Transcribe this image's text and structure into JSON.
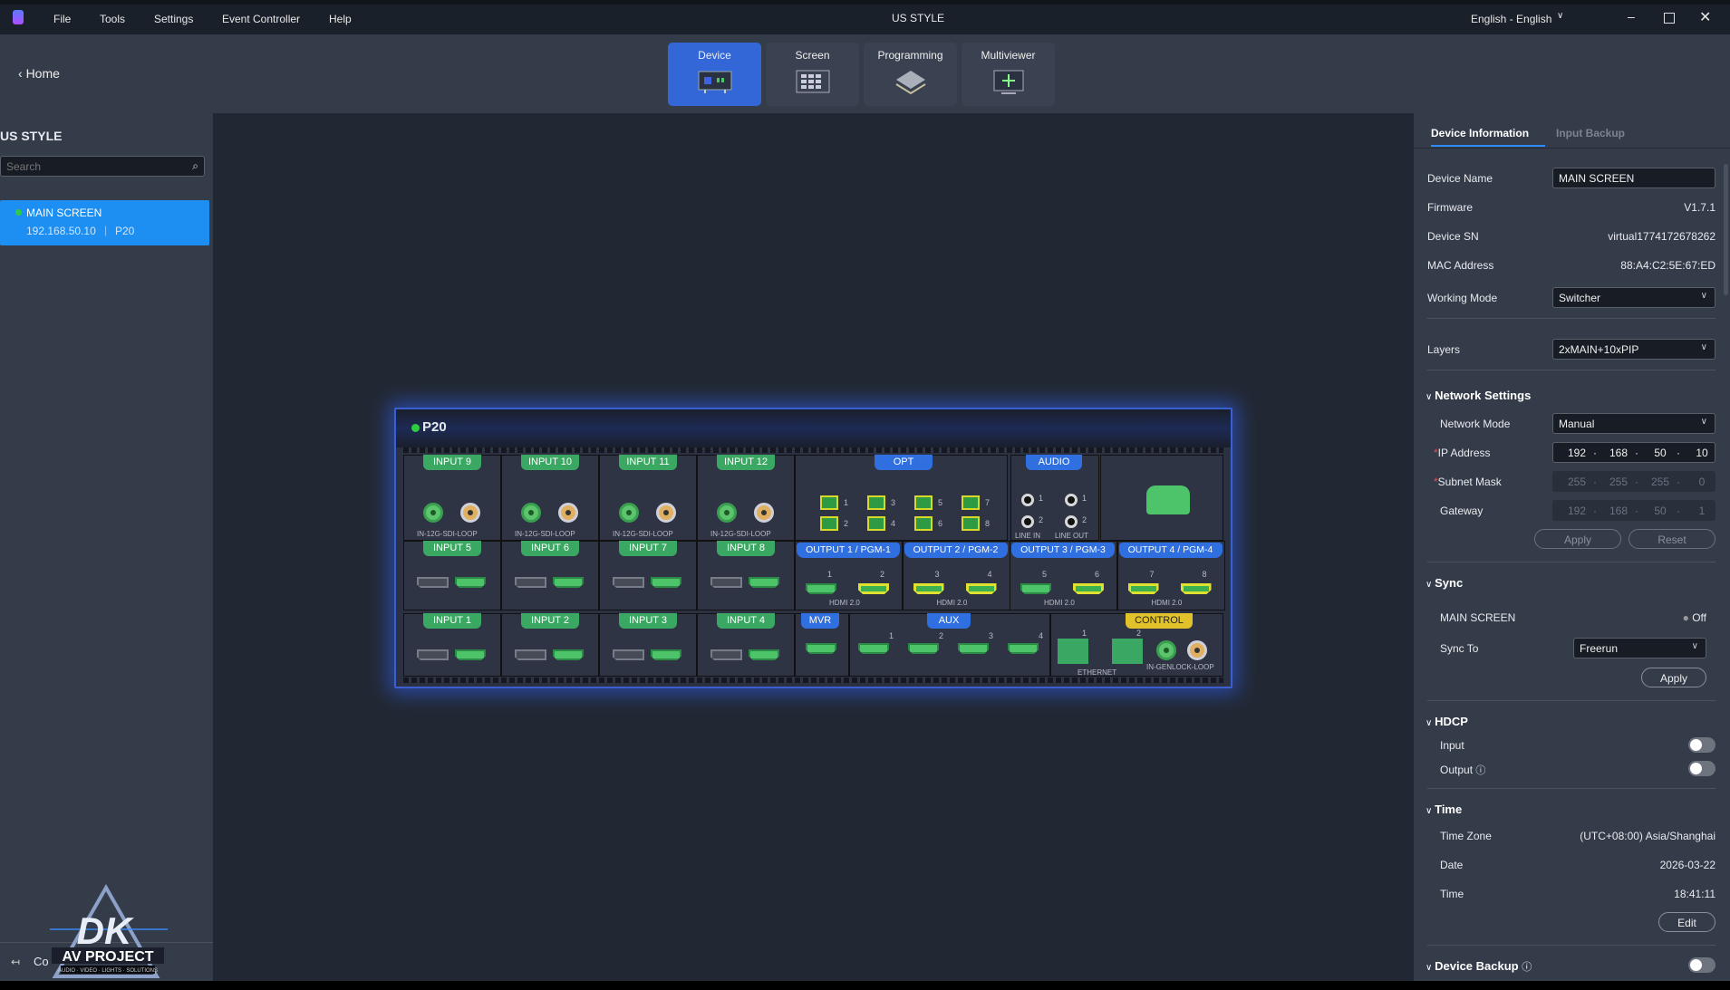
{
  "titlebar": {
    "menu": [
      "File",
      "Tools",
      "Settings",
      "Event Controller",
      "Help"
    ],
    "title": "US STYLE",
    "language": "English - English"
  },
  "header": {
    "home": "Home",
    "tabs": [
      "Device",
      "Screen",
      "Programming",
      "Multiviewer"
    ],
    "active_tab": "Device"
  },
  "sidebar": {
    "project": "US STYLE",
    "search_placeholder": "Search",
    "devices": [
      {
        "name": "MAIN SCREEN",
        "ip": "192.168.50.10",
        "model": "P20",
        "status": "online"
      }
    ],
    "bottom_label": "Co",
    "logo_text": "DK AV PROJECT - AUDIO · VIDEO · LIGHTS · SOLUTIONS"
  },
  "device": {
    "model": "P20",
    "sdi_inputs": [
      "INPUT 9",
      "INPUT 10",
      "INPUT 11",
      "INPUT 12"
    ],
    "sdi_caption": "IN-12G-SDI-LOOP",
    "hdmi_inputs_mid": [
      "INPUT 5",
      "INPUT 6",
      "INPUT 7",
      "INPUT 8"
    ],
    "hdmi_inputs_low": [
      "INPUT 1",
      "INPUT 2",
      "INPUT 3",
      "INPUT 4"
    ],
    "opt": "OPT",
    "opt_ports": [
      "1",
      "2",
      "3",
      "4",
      "5",
      "6",
      "7",
      "8"
    ],
    "audio": "AUDIO",
    "audio_ports": [
      "1",
      "2",
      "1",
      "2"
    ],
    "line_in": "LINE IN",
    "line_out": "LINE OUT",
    "outputs": [
      "OUTPUT 1 / PGM-1",
      "OUTPUT 2 / PGM-2",
      "OUTPUT 3 / PGM-3",
      "OUTPUT 4 / PGM-4"
    ],
    "output_ports": [
      "1",
      "2",
      "3",
      "4",
      "5",
      "6",
      "7",
      "8"
    ],
    "hdmi_caption": "HDMI 2.0",
    "mvr": "MVR",
    "aux": "AUX",
    "aux_ports": [
      "1",
      "2",
      "3",
      "4"
    ],
    "control": "CONTROL",
    "eth_ports": [
      "1",
      "2"
    ],
    "ethernet": "ETHERNET",
    "genlock": "IN-GENLOCK-LOOP"
  },
  "panel": {
    "tabs": [
      "Device Information",
      "Input Backup"
    ],
    "device_name_label": "Device Name",
    "device_name": "MAIN SCREEN",
    "firmware_label": "Firmware",
    "firmware": "V1.7.1",
    "sn_label": "Device SN",
    "sn": "virtual1774172678262",
    "mac_label": "MAC Address",
    "mac": "88:A4:C2:5E:67:ED",
    "working_mode_label": "Working Mode",
    "working_mode": "Switcher",
    "layers_label": "Layers",
    "layers": "2xMAIN+10xPIP",
    "network": {
      "title": "Network Settings",
      "mode_label": "Network Mode",
      "mode": "Manual",
      "ip_label": "IP Address",
      "ip": [
        "192",
        "168",
        "50",
        "10"
      ],
      "mask_label": "Subnet Mask",
      "mask": [
        "255",
        "255",
        "255",
        "0"
      ],
      "gw_label": "Gateway",
      "gw": [
        "192",
        "168",
        "50",
        "1"
      ],
      "apply": "Apply",
      "reset": "Reset"
    },
    "sync": {
      "title": "Sync",
      "screen": "MAIN SCREEN",
      "status": "Off",
      "sync_to_label": "Sync To",
      "sync_to": "Freerun",
      "apply": "Apply"
    },
    "hdcp": {
      "title": "HDCP",
      "input": "Input",
      "output": "Output",
      "input_on": false,
      "output_on": false
    },
    "time": {
      "title": "Time",
      "tz_label": "Time Zone",
      "tz": "(UTC+08:00) Asia/Shanghai",
      "date_label": "Date",
      "date": "2026-03-22",
      "time_label": "Time",
      "time": "18:41:11",
      "edit": "Edit"
    },
    "backup": {
      "title": "Device Backup",
      "enabled": false
    }
  }
}
